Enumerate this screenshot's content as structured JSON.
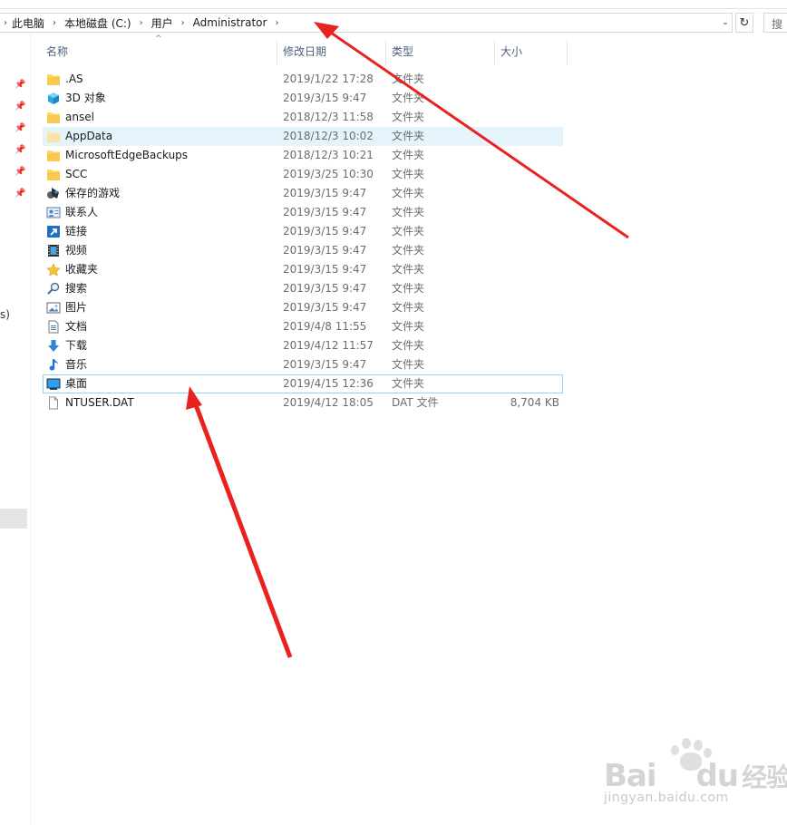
{
  "address_bar": {
    "crumbs": [
      "此电脑",
      "本地磁盘 (C:)",
      "用户",
      "Administrator"
    ]
  },
  "search": {
    "placeholder_visible": "搜"
  },
  "nav_pane": {
    "partial_text": "s)"
  },
  "columns": {
    "name": "名称",
    "date": "修改日期",
    "type": "类型",
    "size": "大小"
  },
  "rows": [
    {
      "name": ".AS",
      "date": "2019/1/22 17:28",
      "type": "文件夹",
      "size": "",
      "icon": "folder-icon"
    },
    {
      "name": "3D 对象",
      "date": "2019/3/15 9:47",
      "type": "文件夹",
      "size": "",
      "icon": "3d-objects-icon"
    },
    {
      "name": "ansel",
      "date": "2018/12/3 11:58",
      "type": "文件夹",
      "size": "",
      "icon": "folder-icon"
    },
    {
      "name": "AppData",
      "date": "2018/12/3 10:02",
      "type": "文件夹",
      "size": "",
      "icon": "hidden-folder-icon",
      "state": "hover"
    },
    {
      "name": "MicrosoftEdgeBackups",
      "date": "2018/12/3 10:21",
      "type": "文件夹",
      "size": "",
      "icon": "folder-icon"
    },
    {
      "name": "SCC",
      "date": "2019/3/25 10:30",
      "type": "文件夹",
      "size": "",
      "icon": "folder-icon"
    },
    {
      "name": "保存的游戏",
      "date": "2019/3/15 9:47",
      "type": "文件夹",
      "size": "",
      "icon": "saved-games-icon"
    },
    {
      "name": "联系人",
      "date": "2019/3/15 9:47",
      "type": "文件夹",
      "size": "",
      "icon": "contacts-icon"
    },
    {
      "name": "链接",
      "date": "2019/3/15 9:47",
      "type": "文件夹",
      "size": "",
      "icon": "links-icon"
    },
    {
      "name": "视频",
      "date": "2019/3/15 9:47",
      "type": "文件夹",
      "size": "",
      "icon": "videos-icon"
    },
    {
      "name": "收藏夹",
      "date": "2019/3/15 9:47",
      "type": "文件夹",
      "size": "",
      "icon": "favorites-icon"
    },
    {
      "name": "搜索",
      "date": "2019/3/15 9:47",
      "type": "文件夹",
      "size": "",
      "icon": "searches-icon"
    },
    {
      "name": "图片",
      "date": "2019/3/15 9:47",
      "type": "文件夹",
      "size": "",
      "icon": "pictures-icon"
    },
    {
      "name": "文档",
      "date": "2019/4/8 11:55",
      "type": "文件夹",
      "size": "",
      "icon": "documents-icon"
    },
    {
      "name": "下载",
      "date": "2019/4/12 11:57",
      "type": "文件夹",
      "size": "",
      "icon": "downloads-icon"
    },
    {
      "name": "音乐",
      "date": "2019/3/15 9:47",
      "type": "文件夹",
      "size": "",
      "icon": "music-icon"
    },
    {
      "name": "桌面",
      "date": "2019/4/15 12:36",
      "type": "文件夹",
      "size": "",
      "icon": "desktop-icon",
      "state": "focused"
    },
    {
      "name": "NTUSER.DAT",
      "date": "2019/4/12 18:05",
      "type": "DAT 文件",
      "size": "8,704 KB",
      "icon": "file-icon"
    }
  ],
  "watermark": {
    "brand": "Bai",
    "brand2": "du",
    "brand3": "经验",
    "url": "jingyan.baidu.com"
  },
  "colors": {
    "hover_row": "#e5f3fb",
    "focus_border": "#99d1ef",
    "arrow": "#e8231f",
    "header_text": "#4c607a"
  }
}
